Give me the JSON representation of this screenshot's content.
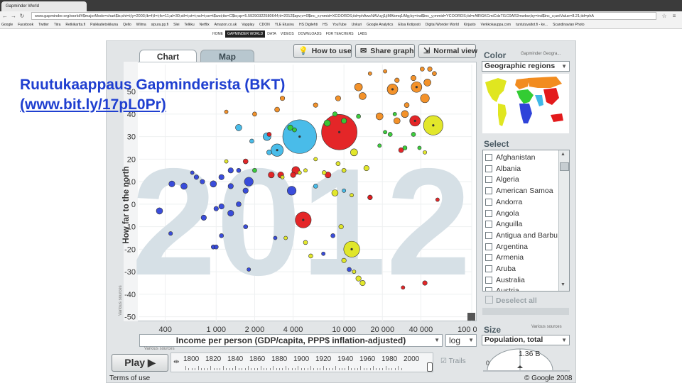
{
  "browser": {
    "tab_title": "Gapminder World",
    "url": "www.gapminder.org/world/#$majorMode=chart$is;shi=t;ly=2003;lb=f;il=t;fs=11;al=30;stl=t;st=t;nsl=t;se=t$wst;tts=C$ts;sp=5.59290322580644;ti=2012$zpv;v=0$inc_x;mmid=XCOORDS;iid=phAwcNAVuyj1jiMAkmq1iMg;by=ind$inc_y;mmid=YCOORDS;iid=rAfRGKCmiCdzTI1C0AR2mwbw;by=ind$inc_s;uniValue=8.21;iid=phA",
    "bookmarks": [
      "Google",
      "Facebook",
      "Twitter",
      "Tiira",
      "Retkikartta.fi",
      "Paikkatietoikkuna",
      "Qello",
      "Wilma",
      "sipura.pp.fi",
      "Slei",
      "Telkku",
      "Netflix",
      "Amazon.co.uk",
      "Vapplay",
      "CDON",
      "YLE Etusivu",
      "HS Digilehti",
      "HS",
      "YouTube",
      "Unkuri",
      "Google Analytics",
      "Elisa Kotiposti",
      "Digital Wonder World",
      "Kirjasto",
      "Verkkokauppa.com",
      "tuntutuvaltot.fi - ke...",
      "Scandinavian Photo"
    ]
  },
  "site_nav": [
    "HOME",
    "GAPMINDER WORLD",
    "DATA",
    "VIDEOS",
    "DOWNLOADS",
    "FOR TEACHERS",
    "LABS"
  ],
  "site_nav_active": "GAPMINDER WORLD",
  "tabs": {
    "chart": "Chart",
    "map": "Map"
  },
  "toolbar": {
    "how_to_use": "How to use",
    "share_graph": "Share graph",
    "normal_view": "Normal view"
  },
  "overlay": {
    "title": "Ruutukaappaus Gapminderista (BKT)",
    "link": "(www.bit.ly/17pL0Pr)"
  },
  "chart_data": {
    "type": "scatter",
    "year_watermark": "2012",
    "ylabel": "How far to the north",
    "ylabel_source": "Various sources",
    "xlabel": "Income per person (GDP/capita, PPP$ inflation-adjusted)",
    "xlabel_source": "Various sources",
    "x_scale": "log",
    "xlim": [
      250,
      100000
    ],
    "ylim": [
      -52,
      62
    ],
    "x_ticks": [
      400,
      1000,
      2000,
      4000,
      10000,
      20000,
      40000,
      100000
    ],
    "x_tick_labels": [
      "400",
      "1 000",
      "2 000",
      "4 000",
      "10 000",
      "20 000",
      "40 000",
      "100 000"
    ],
    "y_ticks": [
      50,
      40,
      30,
      20,
      10,
      0,
      -10,
      -20,
      -30,
      -40,
      -50
    ],
    "y_tick_labels": [
      "50",
      "40",
      "30",
      "20",
      "10",
      "0",
      "-10",
      "-20",
      "-30",
      "-40",
      "-50"
    ],
    "region_colors": {
      "sub_saharan_africa": "#2f43d9",
      "south_asia": "#3fb8e8",
      "middle_east_north_africa": "#33cc33",
      "americas": "#e0e620",
      "east_asia_pacific": "#e31a1c",
      "europe_central_asia": "#f28c1f"
    },
    "points": [
      {
        "x": 4500,
        "y": 30,
        "size": 0.95,
        "region": "south_asia"
      },
      {
        "x": 9200,
        "y": 32,
        "size": 1.0,
        "region": "east_asia_pacific"
      },
      {
        "x": 50000,
        "y": 35,
        "size": 0.55,
        "region": "americas"
      },
      {
        "x": 11500,
        "y": -20,
        "size": 0.45,
        "region": "americas"
      },
      {
        "x": 4800,
        "y": -7,
        "size": 0.45,
        "region": "east_asia_pacific"
      },
      {
        "x": 3000,
        "y": 24,
        "size": 0.35,
        "region": "south_asia"
      },
      {
        "x": 2500,
        "y": 30,
        "size": 0.22,
        "region": "south_asia"
      },
      {
        "x": 3900,
        "y": 6,
        "size": 0.25,
        "region": "sub_saharan_africa"
      },
      {
        "x": 1800,
        "y": 10,
        "size": 0.25,
        "region": "sub_saharan_africa"
      },
      {
        "x": 36000,
        "y": 37,
        "size": 0.3,
        "region": "east_asia_pacific"
      },
      {
        "x": 24000,
        "y": 51,
        "size": 0.3,
        "region": "europe_central_asia"
      },
      {
        "x": 37000,
        "y": 52,
        "size": 0.3,
        "region": "europe_central_asia"
      },
      {
        "x": 14000,
        "y": 48,
        "size": 0.2,
        "region": "europe_central_asia"
      },
      {
        "x": 13000,
        "y": 52,
        "size": 0.22,
        "region": "europe_central_asia"
      },
      {
        "x": 43000,
        "y": 47,
        "size": 0.25,
        "region": "europe_central_asia"
      },
      {
        "x": 45000,
        "y": 54,
        "size": 0.2,
        "region": "europe_central_asia"
      },
      {
        "x": 30000,
        "y": 40,
        "size": 0.2,
        "region": "europe_central_asia"
      },
      {
        "x": 19000,
        "y": 39,
        "size": 0.2,
        "region": "europe_central_asia"
      },
      {
        "x": 26000,
        "y": 37,
        "size": 0.18,
        "region": "europe_central_asia"
      },
      {
        "x": 9000,
        "y": 47,
        "size": 0.15,
        "region": "europe_central_asia"
      },
      {
        "x": 6000,
        "y": 44,
        "size": 0.13,
        "region": "europe_central_asia"
      },
      {
        "x": 35000,
        "y": 56,
        "size": 0.15,
        "region": "europe_central_asia"
      },
      {
        "x": 41000,
        "y": 60,
        "size": 0.12,
        "region": "europe_central_asia"
      },
      {
        "x": 51000,
        "y": 58,
        "size": 0.12,
        "region": "europe_central_asia"
      },
      {
        "x": 47000,
        "y": 60,
        "size": 0.13,
        "region": "europe_central_asia"
      },
      {
        "x": 21000,
        "y": 59,
        "size": 0.1,
        "region": "europe_central_asia"
      },
      {
        "x": 16000,
        "y": 58,
        "size": 0.1,
        "region": "europe_central_asia"
      },
      {
        "x": 26000,
        "y": 55,
        "size": 0.13,
        "region": "europe_central_asia"
      },
      {
        "x": 31000,
        "y": 44,
        "size": 0.14,
        "region": "europe_central_asia"
      },
      {
        "x": 2000,
        "y": 40,
        "size": 0.12,
        "region": "europe_central_asia"
      },
      {
        "x": 3000,
        "y": 42,
        "size": 0.14,
        "region": "europe_central_asia"
      },
      {
        "x": 3300,
        "y": 47,
        "size": 0.13,
        "region": "europe_central_asia"
      },
      {
        "x": 1200,
        "y": 41,
        "size": 0.1,
        "region": "europe_central_asia"
      },
      {
        "x": 3800,
        "y": 34,
        "size": 0.15,
        "region": "middle_east_north_africa"
      },
      {
        "x": 4100,
        "y": 33,
        "size": 0.12,
        "region": "middle_east_north_africa"
      },
      {
        "x": 7400,
        "y": 36,
        "size": 0.18,
        "region": "middle_east_north_africa"
      },
      {
        "x": 10000,
        "y": 37,
        "size": 0.15,
        "region": "middle_east_north_africa"
      },
      {
        "x": 8500,
        "y": 40,
        "size": 0.13,
        "region": "middle_east_north_africa"
      },
      {
        "x": 13000,
        "y": 39,
        "size": 0.12,
        "region": "middle_east_north_africa"
      },
      {
        "x": 23000,
        "y": 31,
        "size": 0.12,
        "region": "middle_east_north_africa"
      },
      {
        "x": 19000,
        "y": 26,
        "size": 0.1,
        "region": "middle_east_north_africa"
      },
      {
        "x": 30000,
        "y": 25,
        "size": 0.12,
        "region": "middle_east_north_africa"
      },
      {
        "x": 39000,
        "y": 25,
        "size": 0.1,
        "region": "middle_east_north_africa"
      },
      {
        "x": 21000,
        "y": 32,
        "size": 0.1,
        "region": "middle_east_north_africa"
      },
      {
        "x": 25000,
        "y": 40,
        "size": 0.1,
        "region": "middle_east_north_africa"
      },
      {
        "x": 35000,
        "y": 31,
        "size": 0.12,
        "region": "middle_east_north_africa"
      },
      {
        "x": 2000,
        "y": 15,
        "size": 0.12,
        "region": "middle_east_north_africa"
      },
      {
        "x": 2600,
        "y": 23,
        "size": 0.14,
        "region": "south_asia"
      },
      {
        "x": 1900,
        "y": 28,
        "size": 0.12,
        "region": "south_asia"
      },
      {
        "x": 1500,
        "y": 34,
        "size": 0.18,
        "region": "south_asia"
      },
      {
        "x": 6000,
        "y": 8,
        "size": 0.12,
        "region": "south_asia"
      },
      {
        "x": 10000,
        "y": 6,
        "size": 0.1,
        "region": "south_asia"
      },
      {
        "x": 1700,
        "y": 19,
        "size": 0.14,
        "region": "east_asia_pacific"
      },
      {
        "x": 2700,
        "y": 13,
        "size": 0.17,
        "region": "east_asia_pacific"
      },
      {
        "x": 3200,
        "y": 13,
        "size": 0.17,
        "region": "east_asia_pacific"
      },
      {
        "x": 4200,
        "y": 15,
        "size": 0.22,
        "region": "east_asia_pacific"
      },
      {
        "x": 4000,
        "y": 13,
        "size": 0.15,
        "region": "east_asia_pacific"
      },
      {
        "x": 7500,
        "y": 13,
        "size": 0.17,
        "region": "east_asia_pacific"
      },
      {
        "x": 16000,
        "y": 3,
        "size": 0.13,
        "region": "east_asia_pacific"
      },
      {
        "x": 16000,
        "y": 3,
        "size": 0.13,
        "region": "east_asia_pacific"
      },
      {
        "x": 28000,
        "y": 24,
        "size": 0.14,
        "region": "east_asia_pacific"
      },
      {
        "x": 43000,
        "y": -35,
        "size": 0.13,
        "region": "east_asia_pacific"
      },
      {
        "x": 29000,
        "y": -37,
        "size": 0.1,
        "region": "east_asia_pacific"
      },
      {
        "x": 54000,
        "y": 2,
        "size": 0.1,
        "region": "east_asia_pacific"
      },
      {
        "x": 2600,
        "y": 31,
        "size": 0.12,
        "region": "east_asia_pacific"
      },
      {
        "x": 12000,
        "y": 23,
        "size": 0.2,
        "region": "americas"
      },
      {
        "x": 15000,
        "y": 16,
        "size": 0.15,
        "region": "americas"
      },
      {
        "x": 10000,
        "y": 15,
        "size": 0.12,
        "region": "americas"
      },
      {
        "x": 7000,
        "y": 14,
        "size": 0.12,
        "region": "americas"
      },
      {
        "x": 5000,
        "y": 15,
        "size": 0.1,
        "region": "americas"
      },
      {
        "x": 3300,
        "y": 12,
        "size": 0.1,
        "region": "americas"
      },
      {
        "x": 8500,
        "y": 5,
        "size": 0.18,
        "region": "americas"
      },
      {
        "x": 11500,
        "y": 4,
        "size": 0.1,
        "region": "americas"
      },
      {
        "x": 13000,
        "y": -33,
        "size": 0.15,
        "region": "americas"
      },
      {
        "x": 14000,
        "y": -35,
        "size": 0.15,
        "region": "americas"
      },
      {
        "x": 10000,
        "y": -25,
        "size": 0.13,
        "region": "americas"
      },
      {
        "x": 9500,
        "y": -10,
        "size": 0.13,
        "region": "americas"
      },
      {
        "x": 5000,
        "y": -17,
        "size": 0.12,
        "region": "americas"
      },
      {
        "x": 5500,
        "y": -23,
        "size": 0.12,
        "region": "americas"
      },
      {
        "x": 6000,
        "y": 20,
        "size": 0.1,
        "region": "americas"
      },
      {
        "x": 4500,
        "y": 14,
        "size": 0.1,
        "region": "americas"
      },
      {
        "x": 1200,
        "y": 19,
        "size": 0.1,
        "region": "americas"
      },
      {
        "x": 9000,
        "y": 18,
        "size": 0.12,
        "region": "americas"
      },
      {
        "x": 12000,
        "y": -30,
        "size": 0.1,
        "region": "americas"
      },
      {
        "x": 3500,
        "y": -15,
        "size": 0.1,
        "region": "americas"
      },
      {
        "x": 43000,
        "y": 23,
        "size": 0.1,
        "region": "americas"
      },
      {
        "x": 450,
        "y": 9,
        "size": 0.17,
        "region": "sub_saharan_africa"
      },
      {
        "x": 560,
        "y": 8,
        "size": 0.18,
        "region": "sub_saharan_africa"
      },
      {
        "x": 700,
        "y": 12,
        "size": 0.13,
        "region": "sub_saharan_africa"
      },
      {
        "x": 780,
        "y": 10,
        "size": 0.13,
        "region": "sub_saharan_africa"
      },
      {
        "x": 650,
        "y": 14,
        "size": 0.1,
        "region": "sub_saharan_africa"
      },
      {
        "x": 950,
        "y": 9,
        "size": 0.18,
        "region": "sub_saharan_africa"
      },
      {
        "x": 1100,
        "y": 12,
        "size": 0.15,
        "region": "sub_saharan_africa"
      },
      {
        "x": 1300,
        "y": 8,
        "size": 0.15,
        "region": "sub_saharan_africa"
      },
      {
        "x": 1500,
        "y": 0,
        "size": 0.14,
        "region": "sub_saharan_africa"
      },
      {
        "x": 1300,
        "y": 15,
        "size": 0.15,
        "region": "sub_saharan_africa"
      },
      {
        "x": 1700,
        "y": 6,
        "size": 0.15,
        "region": "sub_saharan_africa"
      },
      {
        "x": 1100,
        "y": -1,
        "size": 0.15,
        "region": "sub_saharan_africa"
      },
      {
        "x": 1000,
        "y": -2,
        "size": 0.13,
        "region": "sub_saharan_africa"
      },
      {
        "x": 800,
        "y": -6,
        "size": 0.15,
        "region": "sub_saharan_africa"
      },
      {
        "x": 1300,
        "y": -4,
        "size": 0.17,
        "region": "sub_saharan_africa"
      },
      {
        "x": 360,
        "y": -3,
        "size": 0.18,
        "region": "sub_saharan_africa"
      },
      {
        "x": 440,
        "y": -13,
        "size": 0.11,
        "region": "sub_saharan_africa"
      },
      {
        "x": 1100,
        "y": -14,
        "size": 0.12,
        "region": "sub_saharan_africa"
      },
      {
        "x": 950,
        "y": -19,
        "size": 0.12,
        "region": "sub_saharan_africa"
      },
      {
        "x": 1000,
        "y": -19,
        "size": 0.12,
        "region": "sub_saharan_africa"
      },
      {
        "x": 1700,
        "y": -10,
        "size": 0.12,
        "region": "sub_saharan_africa"
      },
      {
        "x": 1800,
        "y": -29,
        "size": 0.1,
        "region": "sub_saharan_africa"
      },
      {
        "x": 11000,
        "y": -29,
        "size": 0.12,
        "region": "sub_saharan_africa"
      },
      {
        "x": 2900,
        "y": -15,
        "size": 0.1,
        "region": "sub_saharan_africa"
      },
      {
        "x": 8200,
        "y": -14,
        "size": 0.12,
        "region": "sub_saharan_africa"
      },
      {
        "x": 1500,
        "y": 15,
        "size": 0.12,
        "region": "sub_saharan_africa"
      },
      {
        "x": 6900,
        "y": -22,
        "size": 0.1,
        "region": "sub_saharan_africa"
      }
    ]
  },
  "xaxis": {
    "scale_label": "log"
  },
  "play": {
    "label": "Play",
    "years": [
      "1800",
      "1820",
      "1840",
      "1860",
      "1880",
      "1900",
      "1920",
      "1940",
      "1960",
      "1980",
      "2000"
    ],
    "trails_label": "Trails",
    "current_year": 2012
  },
  "footer": {
    "terms": "Terms of use",
    "copyright": "© Google 2008"
  },
  "sidebar": {
    "color_title": "Color",
    "color_sub": "Gapminder Geogra...",
    "color_select": "Geographic regions",
    "select_title": "Select",
    "countries": [
      "Afghanistan",
      "Albania",
      "Algeria",
      "American Samoa",
      "Andorra",
      "Angola",
      "Anguilla",
      "Antigua and Barbu...",
      "Argentina",
      "Armenia",
      "Aruba",
      "Australia",
      "Austria"
    ],
    "deselect": "Deselect all",
    "size_title": "Size",
    "size_sub": "Various sources",
    "size_select": "Population, total",
    "size_value": "1.36 B",
    "size_min": "0"
  }
}
